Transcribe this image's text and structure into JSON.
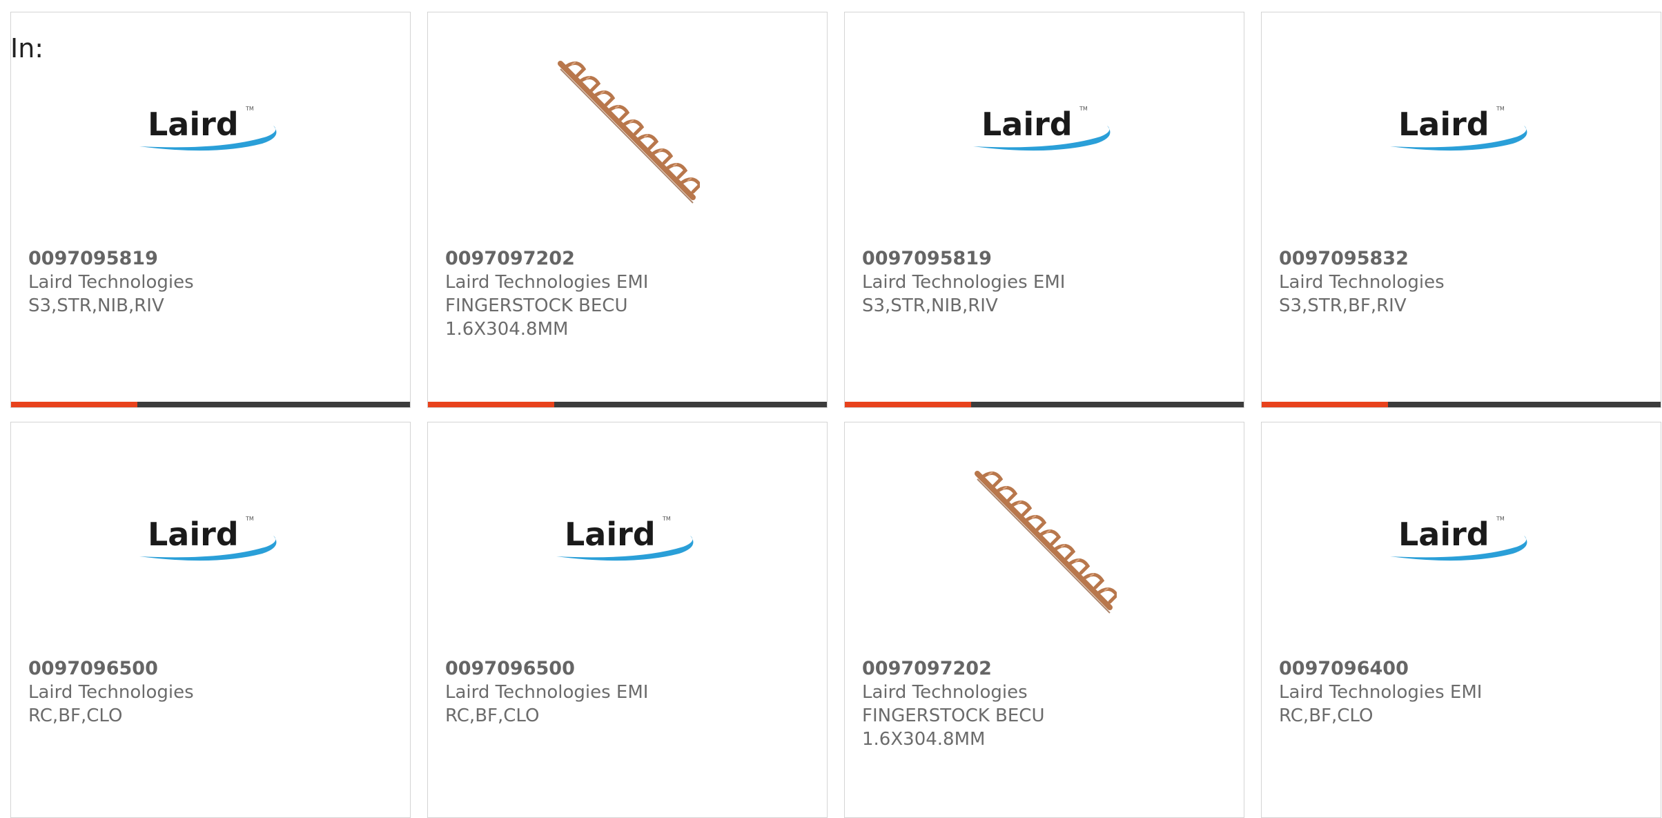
{
  "search_label": "In:",
  "logo_text": "Laird",
  "colors": {
    "accent_bar": "#e8421c",
    "bar_track": "#3c3c3c",
    "logo_swoosh": "#2a9fd8",
    "copper": "#b8774c"
  },
  "products": [
    {
      "part_number": "0097095819",
      "lines": [
        "Laird Technologies",
        "S3,STR,NIB,RIV"
      ],
      "image": "laird-logo",
      "show_bar": true
    },
    {
      "part_number": "0097097202",
      "lines": [
        "Laird Technologies EMI",
        "FINGERSTOCK BECU",
        "1.6X304.8MM"
      ],
      "image": "fingerstock",
      "show_bar": true
    },
    {
      "part_number": "0097095819",
      "lines": [
        "Laird Technologies EMI",
        "S3,STR,NIB,RIV"
      ],
      "image": "laird-logo",
      "show_bar": true
    },
    {
      "part_number": "0097095832",
      "lines": [
        "Laird Technologies",
        "S3,STR,BF,RIV"
      ],
      "image": "laird-logo",
      "show_bar": true
    },
    {
      "part_number": "0097096500",
      "lines": [
        "Laird Technologies",
        "RC,BF,CLO"
      ],
      "image": "laird-logo",
      "show_bar": false
    },
    {
      "part_number": "0097096500",
      "lines": [
        "Laird Technologies EMI",
        "RC,BF,CLO"
      ],
      "image": "laird-logo",
      "show_bar": false
    },
    {
      "part_number": "0097097202",
      "lines": [
        "Laird Technologies",
        "FINGERSTOCK BECU",
        "1.6X304.8MM"
      ],
      "image": "fingerstock",
      "show_bar": false
    },
    {
      "part_number": "0097096400",
      "lines": [
        "Laird Technologies EMI",
        "RC,BF,CLO"
      ],
      "image": "laird-logo",
      "show_bar": false
    }
  ]
}
